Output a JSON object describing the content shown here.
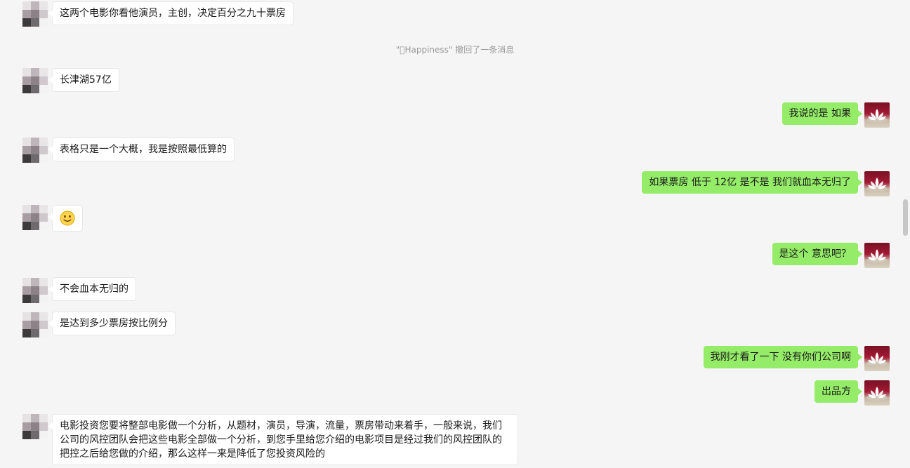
{
  "system_notice": "\"\u0000Happiness\" 撤回了一条消息",
  "messages": {
    "m1": "这两个电影你看他演员，主创，决定百分之九十票房",
    "m2": "长津湖57亿",
    "m3": "我说的是 如果",
    "m4": "表格只是一个大概，我是按照最低算的",
    "m5": "如果票房 低于 12亿  是不是 我们就血本无归了",
    "m6_emoji": "smile-emoji",
    "m7": "是这个 意思吧？",
    "m8": "不会血本无归的",
    "m9": "是达到多少票房按比例分",
    "m10": "我刚才看了一下 没有你们公司啊",
    "m11": "出品方",
    "m12": "电影投资您要将整部电影做一个分析，从题材，演员，导演，流量，票房带动来着手，一般来说，我们公司的风控团队会把这些电影全部做一个分析，到您手里给您介绍的电影项目是经过我们的风控团队的把控之后给您做的介绍，那么这样一来是降低了您投资风险的"
  },
  "colors": {
    "background": "#f5f5f5",
    "incoming_bubble": "#ffffff",
    "outgoing_bubble": "#95ec69",
    "system_text": "#9a9a9a"
  },
  "icons": {
    "incoming_avatar": "pixelated-avatar",
    "outgoing_avatar": "lotus-avatar"
  }
}
